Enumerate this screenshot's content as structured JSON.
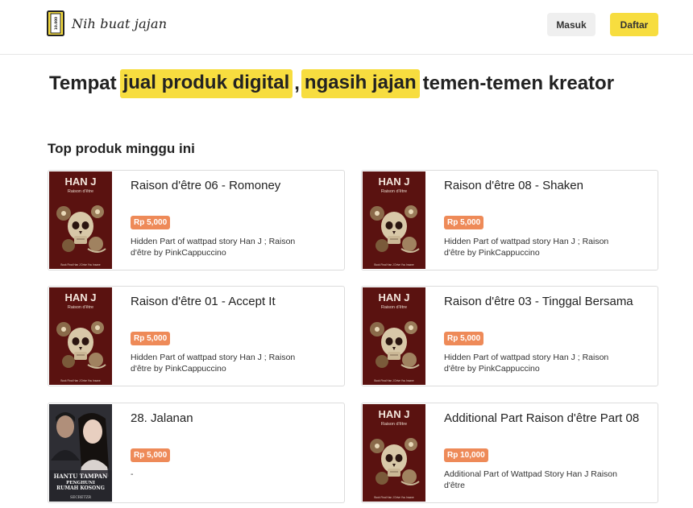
{
  "header": {
    "logo_text": "Nih buat jajan",
    "logo_badge": "10.000",
    "login_label": "Masuk",
    "register_label": "Daftar"
  },
  "hero": {
    "part1": "Tempat",
    "highlight1": "jual produk digital",
    "comma": ",",
    "highlight2": "ngasih jajan",
    "part2": "temen-temen kreator"
  },
  "section": {
    "title": "Top produk minggu ini"
  },
  "colors": {
    "accent_yellow": "#f7dd3f",
    "price_orange": "#ee8a58",
    "cover_maroon": "#5a1210"
  },
  "cover_hanj": {
    "title": "HAN J",
    "subtitle": "Raison d'être",
    "footer": "Book Final Han J Drive You Insane"
  },
  "cover_jalanan": {
    "line1": "HANTU TAMPAN",
    "line2": "PENGHUNI",
    "line3": "RUMAH KOSONG",
    "author": "SECRETZR"
  },
  "products": [
    {
      "title": "Raison d'être 06 - Romoney",
      "price": "Rp 5,000",
      "description": "Hidden Part of wattpad story Han J ; Raison d'être by PinkCappuccino",
      "cover": "hanj"
    },
    {
      "title": "Raison d'être 08 - Shaken",
      "price": "Rp 5,000",
      "description": "Hidden Part of wattpad story Han J ; Raison d'être by PinkCappuccino",
      "cover": "hanj"
    },
    {
      "title": "Raison d'être 01 - Accept It",
      "price": "Rp 5,000",
      "description": "Hidden Part of wattpad story Han J ; Raison d'être by PinkCappuccino",
      "cover": "hanj"
    },
    {
      "title": "Raison d'être 03 - Tinggal Bersama",
      "price": "Rp 5,000",
      "description": " Hidden Part of wattpad story Han J ; Raison d'être by PinkCappuccino",
      "cover": "hanj"
    },
    {
      "title": "28. Jalanan",
      "price": "Rp 5,000",
      "description": "-",
      "cover": "jalanan"
    },
    {
      "title": "Additional Part Raison d'être Part 08",
      "price": "Rp 10,000",
      "description": "Additional Part of Wattpad Story Han J Raison d'être",
      "cover": "hanj"
    }
  ]
}
